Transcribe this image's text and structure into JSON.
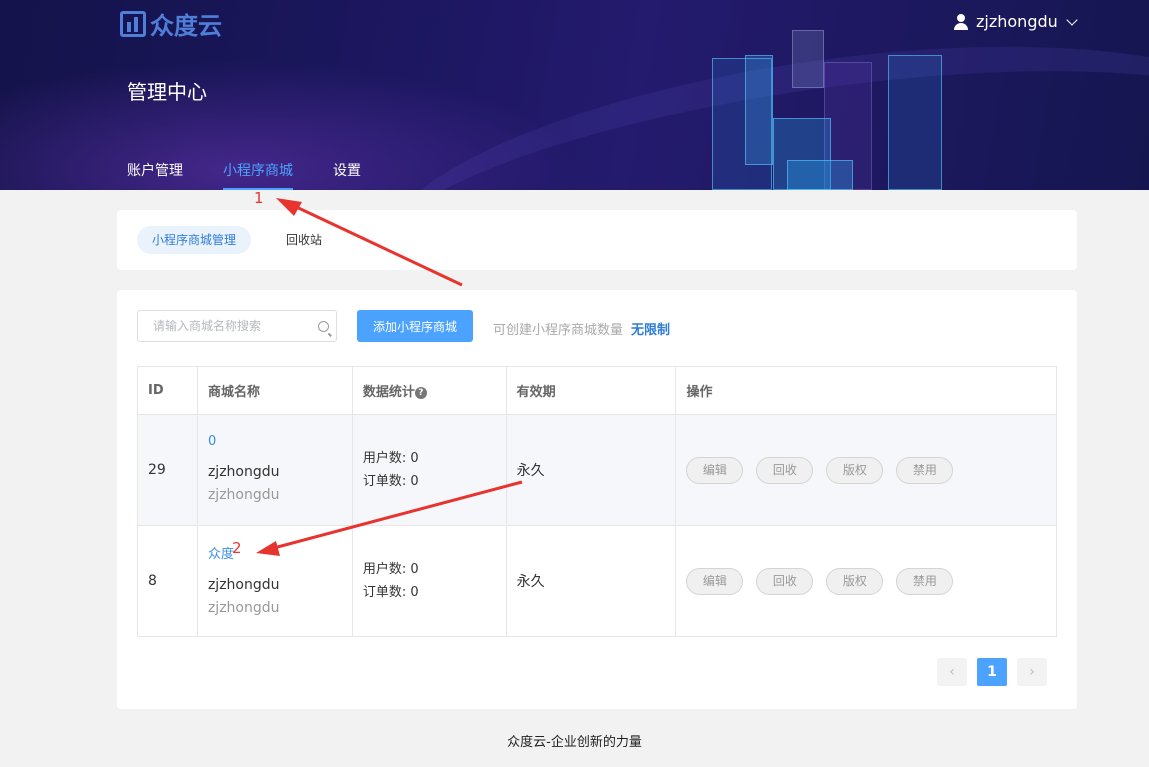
{
  "header": {
    "logo_text": "众度云",
    "user_name": "zjzhongdu",
    "title": "管理中心",
    "nav": [
      {
        "label": "账户管理",
        "active": false
      },
      {
        "label": "小程序商城",
        "active": true
      },
      {
        "label": "设置",
        "active": false
      }
    ]
  },
  "subtabs": [
    {
      "label": "小程序商城管理",
      "active": true
    },
    {
      "label": "回收站",
      "active": false
    }
  ],
  "toolbar": {
    "search_placeholder": "请输入商城名称搜索",
    "add_label": "添加小程序商城",
    "quota_label": "可创建小程序商城数量",
    "quota_value": "无限制"
  },
  "table": {
    "headers": [
      "ID",
      "商城名称",
      "数据统计",
      "有效期",
      "操作"
    ],
    "header_help_icon": "?",
    "rows": [
      {
        "id": "29",
        "name": "0",
        "owner": "zjzhongdu",
        "owner_alias": "zjzhongdu",
        "users": "用户数: 0",
        "orders": "订单数: 0",
        "validity": "永久",
        "actions": [
          "编辑",
          "回收",
          "版权",
          "禁用"
        ]
      },
      {
        "id": "8",
        "name": "众度",
        "owner": "zjzhongdu",
        "owner_alias": "zjzhongdu",
        "users": "用户数: 0",
        "orders": "订单数: 0",
        "validity": "永久",
        "actions": [
          "编辑",
          "回收",
          "版权",
          "禁用"
        ]
      }
    ]
  },
  "pagination": {
    "prev": "‹",
    "current": "1",
    "next": "›"
  },
  "footer": "众度云-企业创新的力量",
  "annotations": [
    {
      "label": "1",
      "color": "#e8342e"
    },
    {
      "label": "2",
      "color": "#e8342e"
    }
  ],
  "colors": {
    "accent": "#4ba3ff",
    "link": "#3a8ee6",
    "header_bg": "#1c1760"
  }
}
